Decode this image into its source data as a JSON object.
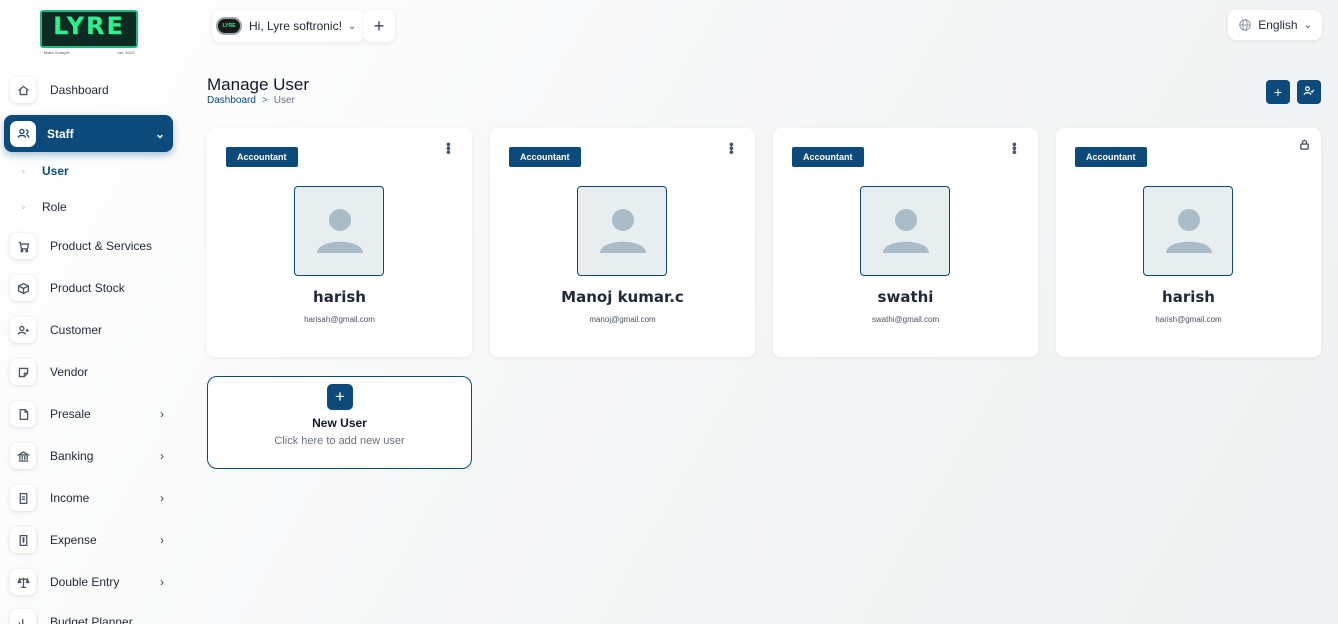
{
  "brand": {
    "logo_text": "LYRE",
    "tagline_left": "Make it simple",
    "tagline_right": "est. 2024",
    "accent": "#0b4a7a",
    "logo_green": "#2ff08f"
  },
  "header": {
    "greeting": "Hi, Lyre softronic!",
    "avatar_text": "LYRE",
    "add_symbol": "+",
    "language": "English"
  },
  "sidebar": {
    "items": [
      {
        "label": "Dashboard",
        "icon": "home-icon"
      },
      {
        "label": "Staff",
        "icon": "users-icon",
        "active": true,
        "expanded": true
      },
      {
        "label": "Product & Services",
        "icon": "cart-icon"
      },
      {
        "label": "Product Stock",
        "icon": "box-icon"
      },
      {
        "label": "Customer",
        "icon": "user-plus-icon"
      },
      {
        "label": "Vendor",
        "icon": "note-icon"
      },
      {
        "label": "Presale",
        "icon": "file-icon",
        "has_children": true
      },
      {
        "label": "Banking",
        "icon": "bank-icon",
        "has_children": true
      },
      {
        "label": "Income",
        "icon": "receipt-icon",
        "has_children": true
      },
      {
        "label": "Expense",
        "icon": "expense-icon",
        "has_children": true
      },
      {
        "label": "Double Entry",
        "icon": "scale-icon",
        "has_children": true
      },
      {
        "label": "Budget Planner",
        "icon": "chart-icon"
      }
    ],
    "sub_items": [
      {
        "label": "User",
        "active": true
      },
      {
        "label": "Role",
        "active": false
      }
    ]
  },
  "main": {
    "title": "Manage User",
    "breadcrumb": [
      "Dashboard",
      "User"
    ],
    "breadcrumb_sep": ">",
    "users": [
      {
        "role": "Accountant",
        "name": "harish",
        "email": "harisah@gmail.com",
        "control": "menu"
      },
      {
        "role": "Accountant",
        "name": "Manoj kumar.c",
        "email": "manoj@gmail.com",
        "control": "menu"
      },
      {
        "role": "Accountant",
        "name": "swathi",
        "email": "swathi@gmail.com",
        "control": "menu"
      },
      {
        "role": "Accountant",
        "name": "harish",
        "email": "harish@gmail.com",
        "control": "lock"
      }
    ],
    "new_user": {
      "plus": "+",
      "title": "New User",
      "subtitle": "Click here to add new user"
    }
  }
}
